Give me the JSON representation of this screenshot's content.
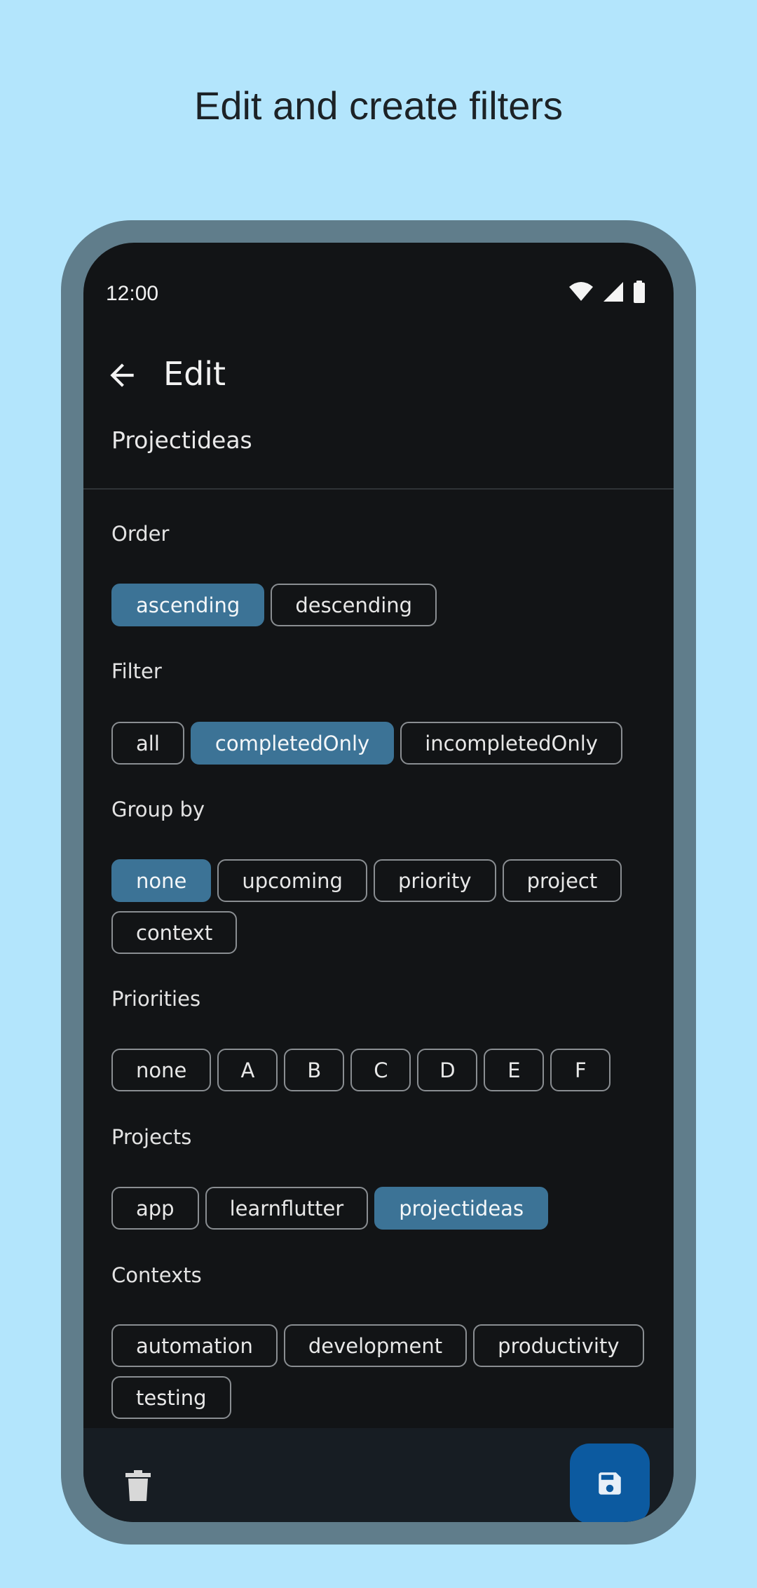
{
  "headline": "Edit and create filters",
  "status_bar": {
    "time": "12:00"
  },
  "app_bar": {
    "title": "Edit"
  },
  "filter_name": "Projectideas",
  "sections": {
    "order": {
      "label": "Order",
      "chips": [
        {
          "label": "ascending",
          "selected": true
        },
        {
          "label": "descending",
          "selected": false
        }
      ]
    },
    "filter": {
      "label": "Filter",
      "chips": [
        {
          "label": "all",
          "selected": false
        },
        {
          "label": "completedOnly",
          "selected": true
        },
        {
          "label": "incompletedOnly",
          "selected": false
        }
      ]
    },
    "group_by": {
      "label": "Group by",
      "chips": [
        {
          "label": "none",
          "selected": true
        },
        {
          "label": "upcoming",
          "selected": false
        },
        {
          "label": "priority",
          "selected": false
        },
        {
          "label": "project",
          "selected": false
        },
        {
          "label": "context",
          "selected": false
        }
      ]
    },
    "priorities": {
      "label": "Priorities",
      "chips": [
        {
          "label": "none",
          "selected": false
        },
        {
          "label": "A",
          "selected": false
        },
        {
          "label": "B",
          "selected": false
        },
        {
          "label": "C",
          "selected": false
        },
        {
          "label": "D",
          "selected": false
        },
        {
          "label": "E",
          "selected": false
        },
        {
          "label": "F",
          "selected": false
        }
      ]
    },
    "projects": {
      "label": "Projects",
      "chips": [
        {
          "label": "app",
          "selected": false
        },
        {
          "label": "learnflutter",
          "selected": false
        },
        {
          "label": "projectideas",
          "selected": true
        }
      ]
    },
    "contexts": {
      "label": "Contexts",
      "chips": [
        {
          "label": "automation",
          "selected": false
        },
        {
          "label": "development",
          "selected": false
        },
        {
          "label": "productivity",
          "selected": false
        },
        {
          "label": "testing",
          "selected": false
        }
      ]
    }
  },
  "icons": {
    "back": "arrow-back-icon",
    "delete": "trash-icon",
    "save": "save-icon",
    "wifi": "wifi-icon",
    "signal": "signal-icon",
    "battery": "battery-icon"
  },
  "colors": {
    "background": "#b3e5fc",
    "frame": "#607d8b",
    "screen": "#121416",
    "chip_selected": "#3c7396",
    "fab": "#0c5aa0"
  }
}
